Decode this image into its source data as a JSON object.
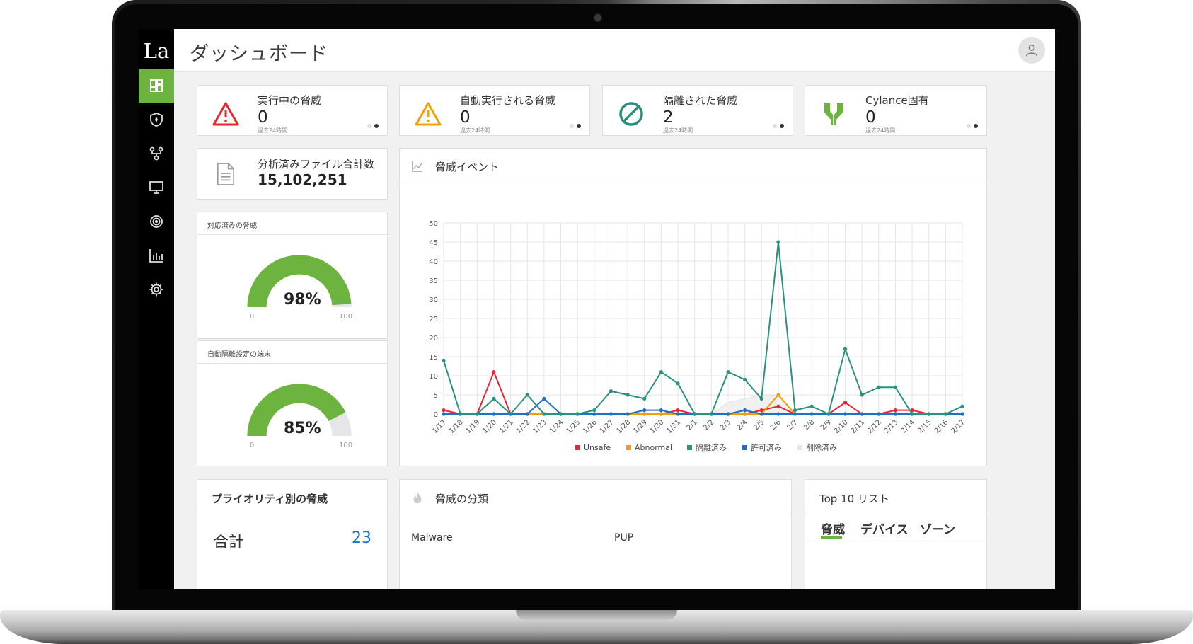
{
  "app": {
    "logo_text": "La",
    "page_title": "ダッシュボード",
    "brand_color": "#6db33f"
  },
  "sidebar": {
    "items": [
      {
        "icon": "dashboard-icon",
        "active": true
      },
      {
        "icon": "shield-icon",
        "active": false
      },
      {
        "icon": "policy-icon",
        "active": false
      },
      {
        "icon": "monitor-icon",
        "active": false
      },
      {
        "icon": "radar-icon",
        "active": false
      },
      {
        "icon": "bar-chart-icon",
        "active": false
      },
      {
        "icon": "gear-icon",
        "active": false
      }
    ]
  },
  "stats": [
    {
      "title": "実行中の脅威",
      "value": "0",
      "sub": "過去24時間",
      "icon": "warning-red-icon",
      "color": "#e8262d"
    },
    {
      "title": "自動実行される脅威",
      "value": "0",
      "sub": "過去24時間",
      "icon": "warning-orange-icon",
      "color": "#f0a000"
    },
    {
      "title": "隔離された脅威",
      "value": "2",
      "sub": "過去24時間",
      "icon": "block-icon",
      "color": "#2a8c7a"
    },
    {
      "title": "Cylance固有",
      "value": "0",
      "sub": "過去24時間",
      "icon": "cylance-icon",
      "color": "#6db33f"
    }
  ],
  "files": {
    "title": "分析済みファイル合計数",
    "value": "15,102,251",
    "icon": "document-icon"
  },
  "gauges": [
    {
      "title": "対応済みの脅威",
      "value": 98,
      "label": "98%",
      "min": "0",
      "max": "100"
    },
    {
      "title": "自動隔離設定の端末",
      "value": 85,
      "label": "85%",
      "min": "0",
      "max": "100"
    }
  ],
  "threat_events": {
    "title": "脅威イベント",
    "icon": "line-chart-icon"
  },
  "chart_data": {
    "type": "line",
    "x": [
      "1/17",
      "1/18",
      "1/19",
      "1/20",
      "1/21",
      "1/22",
      "1/23",
      "1/24",
      "1/25",
      "1/26",
      "1/27",
      "1/28",
      "1/29",
      "1/30",
      "1/31",
      "2/1",
      "2/2",
      "2/3",
      "2/4",
      "2/5",
      "2/6",
      "2/7",
      "2/8",
      "2/9",
      "2/10",
      "2/11",
      "2/12",
      "2/13",
      "2/14",
      "2/15",
      "2/16",
      "2/17"
    ],
    "ylim": [
      0,
      50
    ],
    "yticks": [
      0,
      5,
      10,
      15,
      20,
      25,
      30,
      35,
      40,
      45,
      50
    ],
    "grid": true,
    "legend": "bottom",
    "series": [
      {
        "name": "Unsafe",
        "color": "#e8263a",
        "values": [
          1,
          0,
          0,
          11,
          0,
          0,
          0,
          0,
          0,
          0,
          0,
          0,
          0,
          0,
          1,
          0,
          0,
          0,
          0,
          1,
          2,
          0,
          0,
          0,
          3,
          0,
          0,
          1,
          1,
          0,
          0,
          0
        ]
      },
      {
        "name": "Abnormal",
        "color": "#f0a000",
        "values": [
          0,
          0,
          0,
          0,
          0,
          0,
          0,
          0,
          0,
          0,
          0,
          0,
          0,
          0,
          0,
          0,
          0,
          0,
          0,
          0,
          5,
          0,
          0,
          0,
          0,
          0,
          0,
          0,
          0,
          0,
          0,
          0
        ]
      },
      {
        "name": "隔離済み",
        "color": "#2a9080",
        "values": [
          14,
          0,
          0,
          4,
          0,
          5,
          0,
          0,
          0,
          1,
          6,
          5,
          4,
          11,
          8,
          0,
          0,
          11,
          9,
          4,
          45,
          1,
          2,
          0,
          17,
          5,
          7,
          7,
          0,
          0,
          0,
          2
        ]
      },
      {
        "name": "許可済み",
        "color": "#1f6fc4",
        "values": [
          0,
          0,
          0,
          0,
          0,
          0,
          4,
          0,
          0,
          0,
          0,
          0,
          1,
          1,
          0,
          0,
          0,
          0,
          1,
          0,
          0,
          0,
          0,
          0,
          0,
          0,
          0,
          0,
          0,
          0,
          0,
          0
        ]
      },
      {
        "name": "削除済み",
        "color": "#e6e6e6",
        "values": [
          0,
          0,
          0,
          0,
          0,
          0,
          0,
          0,
          0,
          0,
          0,
          0,
          0,
          0,
          0,
          0,
          0,
          3,
          4,
          5,
          5,
          0,
          0,
          0,
          0,
          0,
          0,
          0,
          0,
          0,
          0,
          0
        ]
      }
    ]
  },
  "priority": {
    "title": "プライオリティ別の脅威",
    "total_label": "合計",
    "total_value": "23"
  },
  "classification": {
    "title": "脅威の分類",
    "col1": "Malware",
    "col2": "PUP",
    "icon": "flame-icon"
  },
  "top10": {
    "title": "Top 10 リスト",
    "tabs": [
      "脅威",
      "デバイス",
      "ゾーン"
    ]
  }
}
